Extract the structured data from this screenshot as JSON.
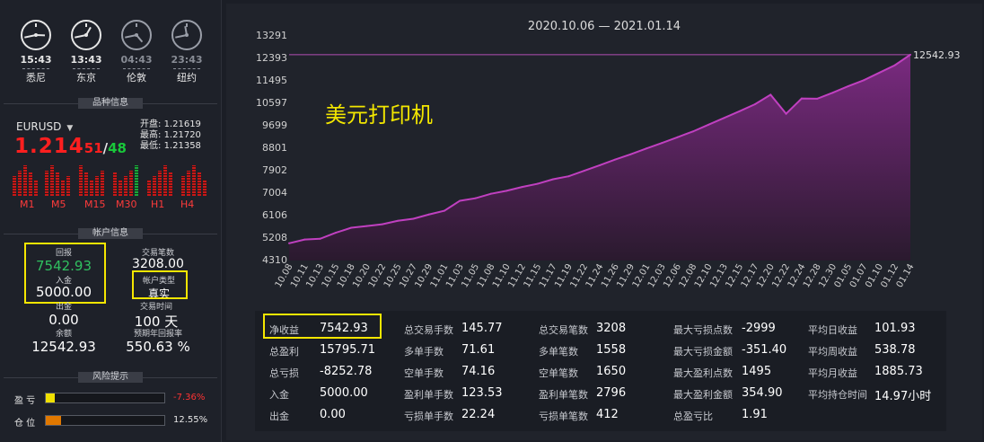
{
  "clocks": [
    {
      "time": "15:43",
      "city": "悉尼",
      "active": true
    },
    {
      "time": "13:43",
      "city": "东京",
      "active": true
    },
    {
      "time": "04:43",
      "city": "伦敦",
      "active": false
    },
    {
      "time": "23:43",
      "city": "纽约",
      "active": false
    }
  ],
  "sections": {
    "symbol_info": "品种信息",
    "account_info": "帐户信息",
    "risk": "风险提示"
  },
  "symbol": {
    "name": "EURUSD",
    "price_main": "1.214",
    "price_small": "51",
    "price_sep": "/",
    "price_ask": "48",
    "open_label": "开盘:",
    "open": "1.21619",
    "high_label": "最高:",
    "high": "1.21720",
    "low_label": "最低:",
    "low": "1.21358",
    "timeframes": [
      "M1",
      "M5",
      "M15",
      "M30",
      "H1",
      "H4"
    ]
  },
  "account": {
    "return_label": "回报",
    "return_value": "7542.93",
    "deposit_label": "入金",
    "deposit_value": "5000.00",
    "trades_label": "交易笔数",
    "trades_value": "3208.00",
    "type_label": "帐户类型",
    "type_value": "真实",
    "withdraw_label": "出金",
    "withdraw_value": "0.00",
    "time_label": "交易时间",
    "time_value": "100 天",
    "balance_label": "余额",
    "balance_value": "12542.93",
    "annual_label": "预期年回报率",
    "annual_value": "550.63 %"
  },
  "risk": {
    "pnl_label": "盈 亏",
    "pnl_pct": "-7.36%",
    "pnl_level": 0.0736,
    "pos_label": "仓 位",
    "pos_pct": "12.55%",
    "pos_level": 0.1255,
    "colors": {
      "pnl": "#f0e000",
      "pos": "#e07800",
      "neg_text": "#ff3333"
    }
  },
  "chart_data": {
    "type": "area",
    "title": "2020.10.06 — 2021.01.14",
    "overlay_text": "美元打印机",
    "last_value_label": "12542.93",
    "yticks": [
      "13291",
      "12393",
      "11495",
      "10597",
      "9699",
      "8801",
      "7902",
      "7004",
      "6106",
      "5208",
      "4310"
    ],
    "ylim": [
      4310,
      13291
    ],
    "xticks": [
      "10.08",
      "10.11",
      "10.13",
      "10.15",
      "10.18",
      "10.20",
      "10.22",
      "10.25",
      "10.27",
      "10.29",
      "11.01",
      "11.03",
      "11.05",
      "11.08",
      "11.10",
      "11.12",
      "11.15",
      "11.17",
      "11.19",
      "11.22",
      "11.24",
      "11.26",
      "11.29",
      "12.01",
      "12.03",
      "12.06",
      "12.08",
      "12.10",
      "12.13",
      "12.15",
      "12.17",
      "12.20",
      "12.22",
      "12.24",
      "12.28",
      "12.30",
      "01.05",
      "01.07",
      "01.10",
      "01.12",
      "01.14"
    ],
    "values": [
      5000,
      5150,
      5180,
      5420,
      5620,
      5690,
      5760,
      5900,
      5980,
      6150,
      6300,
      6700,
      6800,
      6980,
      7100,
      7250,
      7380,
      7560,
      7680,
      7900,
      8120,
      8350,
      8560,
      8790,
      9010,
      9240,
      9470,
      9740,
      10010,
      10280,
      10560,
      10940,
      10180,
      10790,
      10780,
      11020,
      11280,
      11520,
      11820,
      12120,
      12542.93
    ],
    "colors": {
      "line": "#c040c0",
      "area_top": "#7a2a80",
      "area_bottom": "#2a1a2e",
      "ref_line": "#b24fb4"
    }
  },
  "stats": {
    "col1": [
      {
        "k": "净收益",
        "v": "7542.93"
      },
      {
        "k": "总盈利",
        "v": "15795.71"
      },
      {
        "k": "总亏损",
        "v": "-8252.78"
      },
      {
        "k": "入金",
        "v": "5000.00"
      },
      {
        "k": "出金",
        "v": "0.00"
      }
    ],
    "col2": [
      {
        "k": "总交易手数",
        "v": "145.77"
      },
      {
        "k": "多单手数",
        "v": "71.61"
      },
      {
        "k": "空单手数",
        "v": "74.16"
      },
      {
        "k": "盈利单手数",
        "v": "123.53"
      },
      {
        "k": "亏损单手数",
        "v": "22.24"
      }
    ],
    "col3": [
      {
        "k": "总交易笔数",
        "v": "3208"
      },
      {
        "k": "多单笔数",
        "v": "1558"
      },
      {
        "k": "空单笔数",
        "v": "1650"
      },
      {
        "k": "盈利单笔数",
        "v": "2796"
      },
      {
        "k": "亏损单笔数",
        "v": "412"
      }
    ],
    "col4": [
      {
        "k": "最大亏损点数",
        "v": "-2999"
      },
      {
        "k": "最大亏损金额",
        "v": "-351.40"
      },
      {
        "k": "最大盈利点数",
        "v": "1495"
      },
      {
        "k": "最大盈利金额",
        "v": "354.90"
      },
      {
        "k": "总盈亏比",
        "v": "1.91"
      }
    ],
    "col5": [
      {
        "k": "平均日收益",
        "v": "101.93"
      },
      {
        "k": "平均周收益",
        "v": "538.78"
      },
      {
        "k": "平均月收益",
        "v": "1885.73"
      },
      {
        "k": "平均持仓时间",
        "v": "14.97小时"
      }
    ]
  }
}
